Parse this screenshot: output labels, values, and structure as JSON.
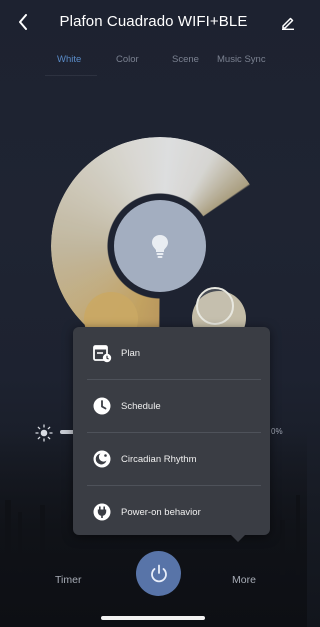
{
  "header": {
    "title": "Plafon Cuadrado WIFI+BLE",
    "back_icon": "back-chevron-icon",
    "edit_icon": "edit-pencil-icon"
  },
  "tabs": [
    {
      "label": "White",
      "active": true
    },
    {
      "label": "Color",
      "active": false
    },
    {
      "label": "Scene",
      "active": false
    },
    {
      "label": "Music Sync",
      "active": false
    }
  ],
  "dial": {
    "center_icon": "bulb-icon"
  },
  "brightness": {
    "icon": "sun-icon",
    "percent_text": "0%"
  },
  "menu": {
    "items": [
      {
        "label": "Plan",
        "icon": "plan-calendar-icon"
      },
      {
        "label": "Schedule",
        "icon": "clock-icon"
      },
      {
        "label": "Circadian Rhythm",
        "icon": "circadian-moon-icon"
      },
      {
        "label": "Power-on behavior",
        "icon": "power-plug-icon"
      }
    ]
  },
  "bottom": {
    "timer_label": "Timer",
    "more_label": "More",
    "power_icon": "power-icon"
  },
  "colors": {
    "accent_tab": "#5a8ac6",
    "power_button": "#5874a8",
    "menu_bg": "#3a3d44"
  }
}
